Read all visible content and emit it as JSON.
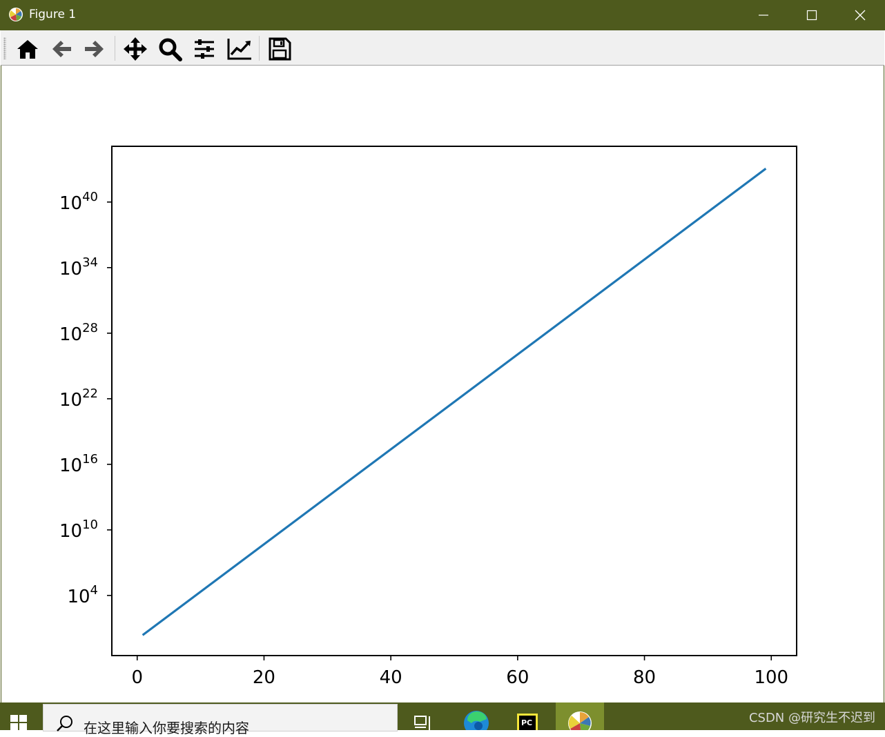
{
  "window": {
    "title": "Figure 1",
    "titlebar_color": "#4e5a1d",
    "buttons": [
      "minimize-icon",
      "maximize-icon",
      "close-icon"
    ]
  },
  "toolbar": {
    "items": [
      "home-icon",
      "back-arrow-icon",
      "forward-arrow-icon",
      "pan-move-icon",
      "zoom-magnifier-icon",
      "configure-subplots-icon",
      "edit-axis-icon",
      "save-floppy-icon"
    ]
  },
  "chart_data": {
    "type": "line",
    "title": "",
    "xlabel": "",
    "ylabel": "",
    "yscale": "log",
    "xlim": [
      -4,
      104
    ],
    "ylim_exponent": [
      -1.5,
      45.1
    ],
    "x_ticks": [
      "0",
      "20",
      "40",
      "60",
      "80",
      "100"
    ],
    "x_tick_values": [
      0,
      20,
      40,
      60,
      80,
      100
    ],
    "y_ticks": [
      {
        "base": "10",
        "exp": "4",
        "value": 10000.0
      },
      {
        "base": "10",
        "exp": "10",
        "value": 10000000000.0
      },
      {
        "base": "10",
        "exp": "16",
        "value": 1e+16
      },
      {
        "base": "10",
        "exp": "22",
        "value": 1e+22
      },
      {
        "base": "10",
        "exp": "28",
        "value": 1e+28
      },
      {
        "base": "10",
        "exp": "34",
        "value": 1e+34
      },
      {
        "base": "10",
        "exp": "40",
        "value": 1e+40
      }
    ],
    "series": [
      {
        "color": "#1f77b4",
        "x": [
          1,
          99
        ],
        "y": [
          2.72,
          9.889e+42
        ]
      }
    ],
    "grid": false,
    "legend": "none"
  },
  "taskbar": {
    "search_placeholder": "在这里输入你要搜索的内容",
    "watermark": "CSDN @研究生不迟到",
    "items": [
      "task-view-icon",
      "edge-browser-icon",
      "pycharm-icon",
      "matplotlib-figure-icon"
    ]
  }
}
